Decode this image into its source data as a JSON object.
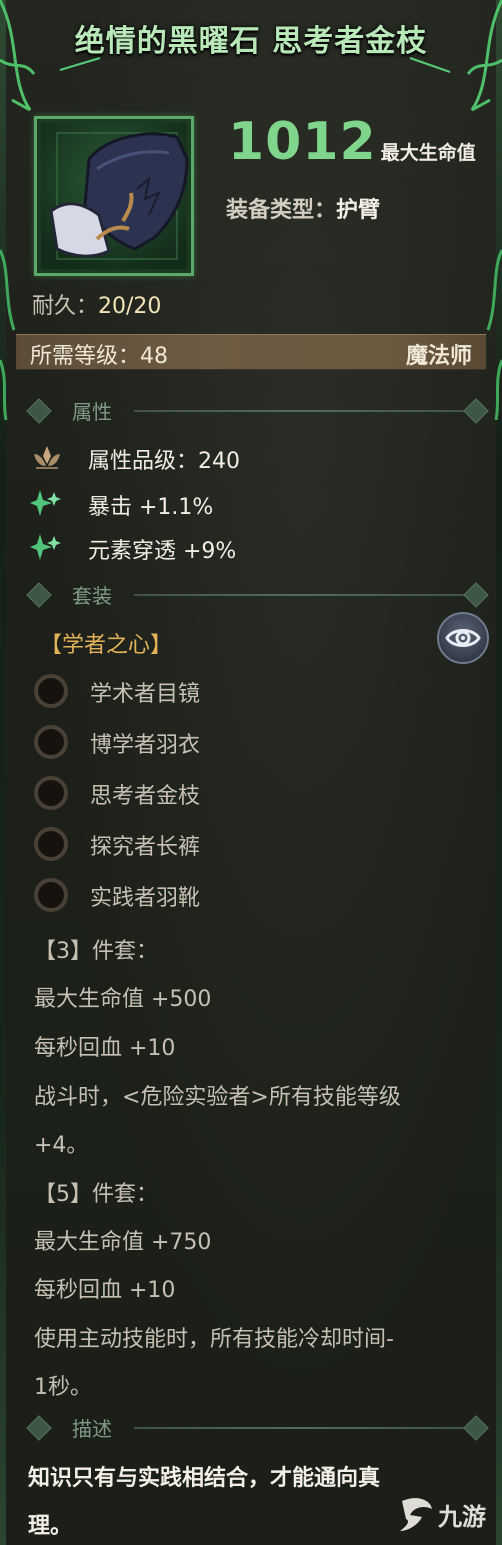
{
  "title": "绝情的黑曜石 思考者金枝",
  "item": {
    "power_value": "1012",
    "power_label": "最大生命值",
    "equip_type_key": "装备类型：",
    "equip_type_value": "护臂",
    "durability_key": "耐久：",
    "durability_value": "20/20",
    "required_level": "所需等级：48",
    "required_class": "魔法师"
  },
  "sections": {
    "attributes": "属性",
    "set": "套装",
    "description": "描述"
  },
  "attributes": [
    {
      "icon": "crown-lotus-icon",
      "text": "属性品级：240"
    },
    {
      "icon": "sparkle-icon",
      "text": "暴击 +1.1%"
    },
    {
      "icon": "sparkle-icon",
      "text": "元素穿透 +9%"
    }
  ],
  "set": {
    "name": "【学者之心】",
    "pieces": [
      "学术者目镜",
      "博学者羽衣",
      "思考者金枝",
      "探究者长裤",
      "实践者羽靴"
    ],
    "bonuses": [
      "【3】件套：",
      "最大生命值 +500",
      "每秒回血 +10",
      "战斗时，<危险实验者>所有技能等级",
      "+4。",
      "【5】件套：",
      "最大生命值 +750",
      "每秒回血 +10",
      "使用主动技能时，所有技能冷却时间-",
      "1秒。"
    ]
  },
  "description_lines": [
    "知识只有与实践相结合，才能通向真",
    "理。"
  ],
  "watermark": "九游",
  "colors": {
    "title_green": "#b8e8b8",
    "power_green": "#7ed58b",
    "set_name_gold": "#e3b35a",
    "requirement_bar": "#6e5b43"
  }
}
